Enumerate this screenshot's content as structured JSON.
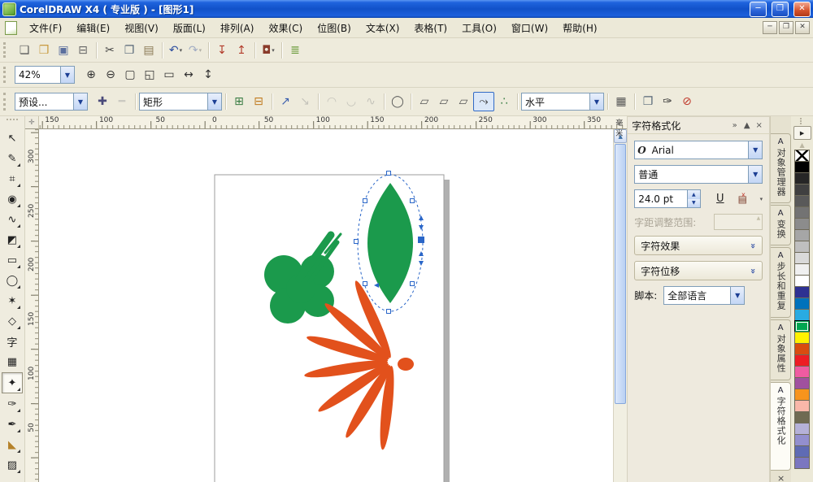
{
  "window": {
    "title": "CorelDRAW X4 ( 专业版 ) - [图形1]",
    "controls": [
      {
        "name": "minimize-button",
        "icon": "minimize-icon"
      },
      {
        "name": "maximize-button",
        "icon": "maximize-icon"
      },
      {
        "name": "close-button",
        "icon": "close-icon"
      }
    ]
  },
  "menubar": {
    "items": [
      {
        "label": "文件(F)"
      },
      {
        "label": "编辑(E)"
      },
      {
        "label": "视图(V)"
      },
      {
        "label": "版面(L)"
      },
      {
        "label": "排列(A)"
      },
      {
        "label": "效果(C)"
      },
      {
        "label": "位图(B)"
      },
      {
        "label": "文本(X)"
      },
      {
        "label": "表格(T)"
      },
      {
        "label": "工具(O)"
      },
      {
        "label": "窗口(W)"
      },
      {
        "label": "帮助(H)"
      }
    ],
    "mdi_controls": [
      {
        "name": "mdi-minimize-button",
        "icon": "minimize-icon"
      },
      {
        "name": "mdi-restore-button",
        "icon": "restore-icon"
      },
      {
        "name": "mdi-close-button",
        "icon": "close-icon"
      }
    ]
  },
  "toolbar_standard": {
    "buttons": [
      {
        "name": "new-document-button",
        "icon": "new-document-icon"
      },
      {
        "name": "open-button",
        "icon": "open-folder-icon"
      },
      {
        "name": "save-button",
        "icon": "save-icon"
      },
      {
        "name": "print-button",
        "icon": "print-icon"
      },
      {
        "name": "cut-button",
        "icon": "cut-icon",
        "group": true
      },
      {
        "name": "copy-button",
        "icon": "copy-icon"
      },
      {
        "name": "paste-button",
        "icon": "paste-icon"
      },
      {
        "name": "undo-button",
        "icon": "undo-icon",
        "dropdown": true,
        "group": true
      },
      {
        "name": "redo-button",
        "icon": "redo-icon",
        "dropdown": true,
        "disabled": true
      },
      {
        "name": "import-button",
        "icon": "import-icon",
        "group": true
      },
      {
        "name": "export-button",
        "icon": "export-icon"
      },
      {
        "name": "app-launcher-button",
        "icon": "app-launcher-icon",
        "dropdown": true,
        "group": true
      },
      {
        "name": "options-button",
        "icon": "options-icon",
        "group": true
      }
    ]
  },
  "toolbar_zoom": {
    "zoom_value": "42%",
    "buttons": [
      {
        "name": "zoom-in-button",
        "icon": "zoom-in-icon"
      },
      {
        "name": "zoom-out-button",
        "icon": "zoom-out-icon"
      },
      {
        "name": "zoom-selected-button",
        "icon": "zoom-selected-icon"
      },
      {
        "name": "zoom-all-objects-button",
        "icon": "zoom-all-icon"
      },
      {
        "name": "zoom-page-button",
        "icon": "zoom-page-icon"
      },
      {
        "name": "zoom-page-width-button",
        "icon": "zoom-width-icon"
      },
      {
        "name": "zoom-page-height-button",
        "icon": "zoom-height-icon"
      }
    ]
  },
  "property_bar": {
    "preset_value": "预设...",
    "shape_value": "矩形",
    "direction_value": "水平",
    "preset_buttons": [
      {
        "name": "add-preset-button",
        "icon": "add-preset-icon"
      },
      {
        "name": "remove-preset-button",
        "icon": "remove-preset-icon",
        "disabled": true
      }
    ],
    "mid_buttons": [
      {
        "name": "add-node-button",
        "icon": "add-node-icon",
        "group": true
      },
      {
        "name": "remove-node-button",
        "icon": "remove-node-icon"
      },
      {
        "name": "join-nodes-button",
        "icon": "join-node-icon",
        "group": true
      },
      {
        "name": "break-nodes-button",
        "icon": "break-node-icon",
        "disabled": true
      },
      {
        "name": "curve-arc-button",
        "icon": "arc1-icon",
        "group": true,
        "disabled": true
      },
      {
        "name": "curve-smooth-button",
        "icon": "arc2-icon",
        "disabled": true
      },
      {
        "name": "curve-wave-button",
        "icon": "arc3-icon",
        "disabled": true
      },
      {
        "name": "circle-handles-button",
        "icon": "circle-handles-icon",
        "group": true
      },
      {
        "name": "envelope-straight-button",
        "icon": "env-straight-icon",
        "group": true
      },
      {
        "name": "envelope-single-arc-button",
        "icon": "env-arc-icon"
      },
      {
        "name": "envelope-double-arc-button",
        "icon": "env-double-arc-icon"
      },
      {
        "name": "envelope-unconstrained-button",
        "icon": "env-unconstrained-icon",
        "selected": true
      },
      {
        "name": "add-new-envelope-button",
        "icon": "add-envelope-icon"
      }
    ],
    "tail_buttons": [
      {
        "name": "retain-lines-button",
        "icon": "retain-lines-icon",
        "group": true
      },
      {
        "name": "copy-properties-button",
        "icon": "copy-props-icon",
        "group": true
      },
      {
        "name": "eyedropper-pick-button",
        "icon": "eyedropper2-icon"
      },
      {
        "name": "clear-envelope-button",
        "icon": "clear-envelope-icon"
      }
    ]
  },
  "toolbox": {
    "tools": [
      {
        "name": "pick-tool",
        "icon": "pick-icon"
      },
      {
        "name": "shape-tool",
        "icon": "shape-icon",
        "flyout": true
      },
      {
        "name": "crop-tool",
        "icon": "crop-icon",
        "flyout": true
      },
      {
        "name": "zoom-tool",
        "icon": "zoom-icon",
        "flyout": true
      },
      {
        "name": "freehand-tool",
        "icon": "freehand-icon",
        "flyout": true
      },
      {
        "name": "smart-fill-tool",
        "icon": "smart-fill-icon",
        "flyout": true
      },
      {
        "name": "rectangle-tool",
        "icon": "rectangle-icon",
        "flyout": true
      },
      {
        "name": "ellipse-tool",
        "icon": "ellipse-icon",
        "flyout": true
      },
      {
        "name": "polygon-tool",
        "icon": "polygon-icon",
        "flyout": true
      },
      {
        "name": "basic-shapes-tool",
        "icon": "basic-shapes-icon",
        "flyout": true
      },
      {
        "name": "text-tool",
        "icon": "text-icon"
      },
      {
        "name": "table-tool",
        "icon": "table-icon"
      },
      {
        "name": "interactive-distortion-tool",
        "icon": "distortion-icon",
        "flyout": true,
        "selected": true
      },
      {
        "name": "eyedropper-tool",
        "icon": "eyedropper-icon",
        "flyout": true
      },
      {
        "name": "outline-tool",
        "icon": "outline-icon",
        "flyout": true
      },
      {
        "name": "fill-tool",
        "icon": "fill-icon",
        "flyout": true
      },
      {
        "name": "interactive-fill-tool",
        "icon": "interactive-fill-icon",
        "flyout": true
      }
    ]
  },
  "rulers": {
    "unit": "毫米",
    "h_labels": [
      {
        "text": "150",
        "mm": -150
      },
      {
        "text": "100",
        "mm": -100
      },
      {
        "text": "50",
        "mm": -50
      },
      {
        "text": "0",
        "mm": 0
      },
      {
        "text": "50",
        "mm": 50
      },
      {
        "text": "100",
        "mm": 100
      },
      {
        "text": "150",
        "mm": 150
      },
      {
        "text": "200",
        "mm": 200
      },
      {
        "text": "250",
        "mm": 250
      },
      {
        "text": "300",
        "mm": 300
      },
      {
        "text": "350",
        "mm": 350
      }
    ],
    "v_labels": [
      {
        "text": "300",
        "mm": 300
      },
      {
        "text": "250",
        "mm": 250
      },
      {
        "text": "200",
        "mm": 200
      },
      {
        "text": "150",
        "mm": 150
      },
      {
        "text": "100",
        "mm": 100
      },
      {
        "text": "50",
        "mm": 50
      }
    ]
  },
  "docker": {
    "title": "字符格式化",
    "header_buttons": [
      {
        "name": "docker-quick-customize-button",
        "icon": "double-chevron-icon",
        "glyph": "»"
      },
      {
        "name": "docker-collapse-button",
        "icon": "collapse-icon",
        "glyph": "▲"
      },
      {
        "name": "docker-close-button",
        "icon": "close-icon",
        "glyph": "×"
      }
    ],
    "font_family": "Arial",
    "font_glyph": "O",
    "font_style": "普通",
    "font_size": "24.0 pt",
    "underline_label": "U",
    "kerning_label": "字距调整范围:",
    "sections": [
      {
        "label": "字符效果"
      },
      {
        "label": "字符位移"
      }
    ],
    "script_label": "脚本:",
    "script_value": "全部语言"
  },
  "docker_tabs": {
    "tabs": [
      {
        "label": "对象管理器",
        "icon": "object-manager-icon"
      },
      {
        "label": "变换",
        "icon": "transform-icon"
      },
      {
        "label": "步长和重复",
        "icon": "step-repeat-icon"
      },
      {
        "label": "对象属性",
        "icon": "object-properties-icon"
      },
      {
        "label": "字符格式化",
        "icon": "character-formatting-icon",
        "active": true
      }
    ],
    "close_label": "×"
  },
  "color_palette": {
    "colors": [
      "none",
      "#000000",
      "#262626",
      "#404040",
      "#595959",
      "#737373",
      "#8c8c8c",
      "#a6a6a6",
      "#bfbfbf",
      "#d9d9d9",
      "#f0f0f0",
      "#ffffff",
      "#2e3192",
      "#0072bc",
      "#29abe2",
      "#00a651",
      "#fff200",
      "#d94c10",
      "#ed1c24",
      "#ef5ba1",
      "#a0519f",
      "#f7941d",
      "#f9b7a9",
      "#6f6a52",
      "#b5b1d8",
      "#938fce",
      "#5f6bb4",
      "#7b76c0"
    ],
    "selected_index": 15
  },
  "canvas": {
    "fill_green": "#1b9a4c",
    "fill_orange": "#e2511c",
    "selection_blue": "#2a66c8",
    "page_shadow": "#b0b0b0",
    "page_stroke": "#9c9c9c"
  }
}
